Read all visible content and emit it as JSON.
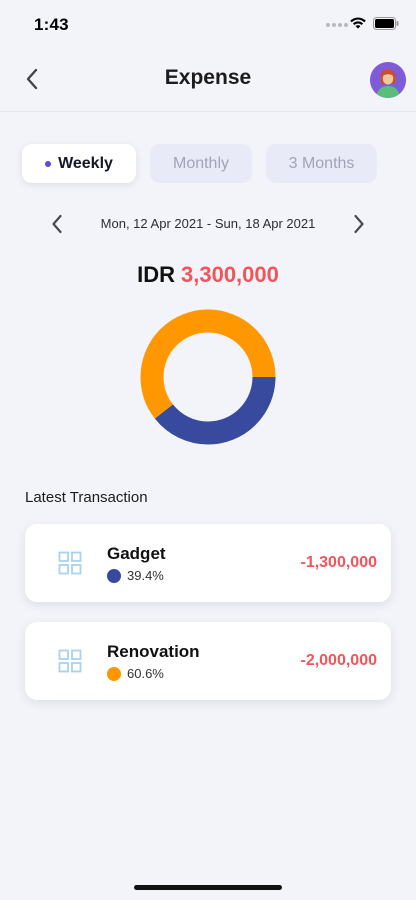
{
  "status_bar": {
    "time": "1:43"
  },
  "nav": {
    "title": "Expense",
    "back_icon": "chevron-left-icon",
    "avatar_icon": "user-avatar"
  },
  "period_tabs": [
    {
      "label": "Weekly",
      "selected": true
    },
    {
      "label": "Monthly",
      "selected": false
    },
    {
      "label": "3 Months",
      "selected": false
    }
  ],
  "date_range": {
    "label": "Mon, 12 Apr 2021 - Sun, 18 Apr 2021"
  },
  "total": {
    "currency": "IDR",
    "amount": "3,300,000"
  },
  "donut": {
    "segments": [
      {
        "name": "Gadget",
        "percent": 39.4,
        "color": "#374a9e"
      },
      {
        "name": "Renovation",
        "percent": 60.6,
        "color": "#ff9800"
      }
    ]
  },
  "latest": {
    "title": "Latest Transaction"
  },
  "transactions": [
    {
      "name": "Gadget",
      "percent": "39.4%",
      "amount": "-1,300,000",
      "color": "#374a9e",
      "icon": "grid-icon"
    },
    {
      "name": "Renovation",
      "percent": "60.6%",
      "amount": "-2,000,000",
      "color": "#ff9800",
      "icon": "grid-icon"
    }
  ],
  "colors": {
    "accent": "#5b4bd6",
    "negative": "#f2545b",
    "background": "#f3f4f9"
  }
}
